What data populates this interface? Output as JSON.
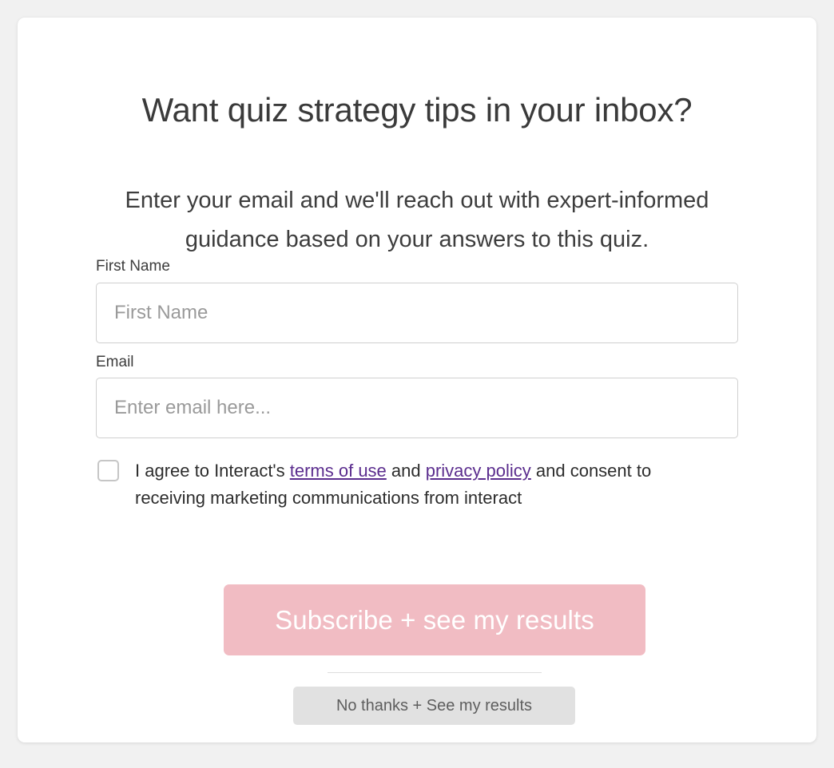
{
  "card": {
    "headline": "Want quiz strategy tips in your inbox?",
    "subhead": "Enter your email and we'll reach out with expert-informed guidance based on your answers to this quiz."
  },
  "form": {
    "first_name": {
      "label": "First Name",
      "placeholder": "First Name",
      "value": ""
    },
    "email": {
      "label": "Email",
      "placeholder": "Enter email here...",
      "value": ""
    },
    "consent": {
      "checked": false,
      "text_part1": "I agree to Interact's ",
      "terms_link": "terms of use",
      "text_part2": " and ",
      "privacy_link": "privacy policy",
      "text_part3": " and consent to receiving marketing communications from interact"
    }
  },
  "actions": {
    "subscribe_label": "Subscribe + see my results",
    "no_thanks_label": "No thanks + See my results"
  },
  "colors": {
    "page_background": "#f1f1f1",
    "card_background": "#ffffff",
    "subscribe_button": "#f1bcc3",
    "subscribe_text": "#ffffff",
    "no_thanks_button": "#e1e1e1",
    "no_thanks_text": "#5e5e5e",
    "link": "#5b2d8e",
    "input_border": "#cfcfcf",
    "checkbox_border": "#c6c6c6",
    "heading_text": "#3a3a3a",
    "body_text": "#2d2d2d",
    "placeholder_text": "#9a9a9a",
    "divider": "#dedede"
  }
}
